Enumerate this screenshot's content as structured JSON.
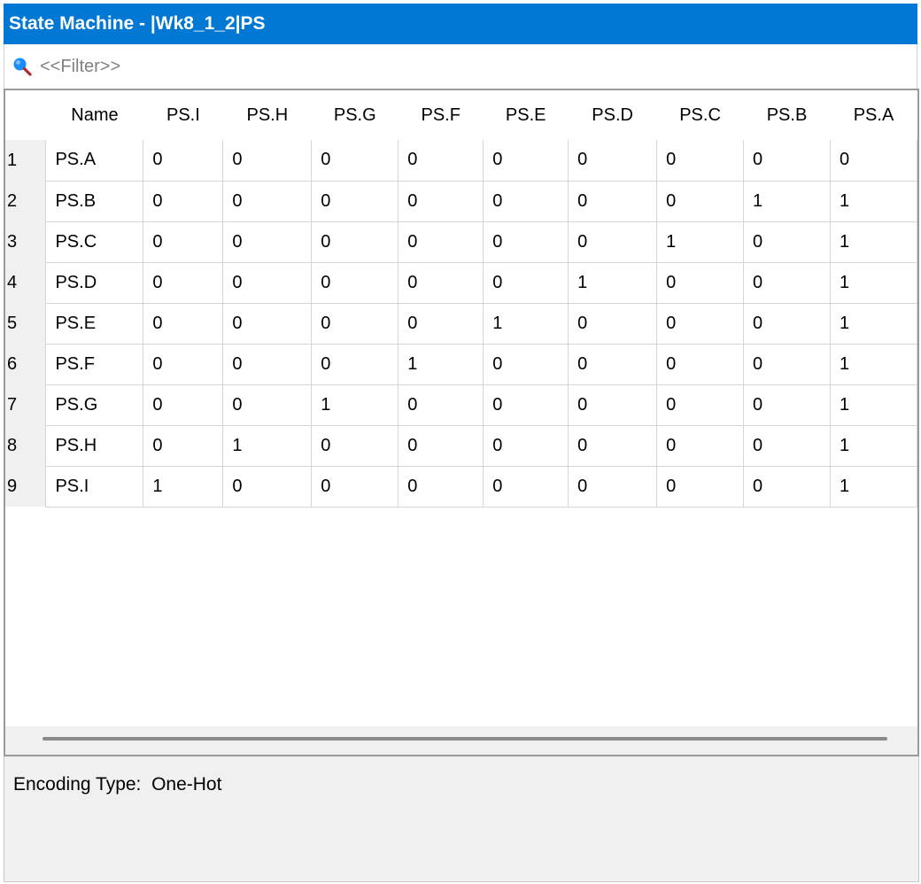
{
  "window": {
    "title": "State Machine - |Wk8_1_2|PS"
  },
  "filter": {
    "placeholder": "<<Filter>>",
    "value": ""
  },
  "table": {
    "columns": [
      "Name",
      "PS.I",
      "PS.H",
      "PS.G",
      "PS.F",
      "PS.E",
      "PS.D",
      "PS.C",
      "PS.B",
      "PS.A"
    ],
    "rows": [
      {
        "num": "1",
        "cells": [
          "PS.A",
          "0",
          "0",
          "0",
          "0",
          "0",
          "0",
          "0",
          "0",
          "0"
        ]
      },
      {
        "num": "2",
        "cells": [
          "PS.B",
          "0",
          "0",
          "0",
          "0",
          "0",
          "0",
          "0",
          "1",
          "1"
        ]
      },
      {
        "num": "3",
        "cells": [
          "PS.C",
          "0",
          "0",
          "0",
          "0",
          "0",
          "0",
          "1",
          "0",
          "1"
        ]
      },
      {
        "num": "4",
        "cells": [
          "PS.D",
          "0",
          "0",
          "0",
          "0",
          "0",
          "1",
          "0",
          "0",
          "1"
        ]
      },
      {
        "num": "5",
        "cells": [
          "PS.E",
          "0",
          "0",
          "0",
          "0",
          "1",
          "0",
          "0",
          "0",
          "1"
        ]
      },
      {
        "num": "6",
        "cells": [
          "PS.F",
          "0",
          "0",
          "0",
          "1",
          "0",
          "0",
          "0",
          "0",
          "1"
        ]
      },
      {
        "num": "7",
        "cells": [
          "PS.G",
          "0",
          "0",
          "1",
          "0",
          "0",
          "0",
          "0",
          "0",
          "1"
        ]
      },
      {
        "num": "8",
        "cells": [
          "PS.H",
          "0",
          "1",
          "0",
          "0",
          "0",
          "0",
          "0",
          "0",
          "1"
        ]
      },
      {
        "num": "9",
        "cells": [
          "PS.I",
          "1",
          "0",
          "0",
          "0",
          "0",
          "0",
          "0",
          "0",
          "1"
        ]
      }
    ]
  },
  "footer": {
    "encoding_label": "Encoding Type:",
    "encoding_value": "One-Hot"
  },
  "colors": {
    "titlebar": "#0078d4",
    "search_icon": "#1a8cff"
  },
  "icons": {
    "search": "search-icon"
  }
}
